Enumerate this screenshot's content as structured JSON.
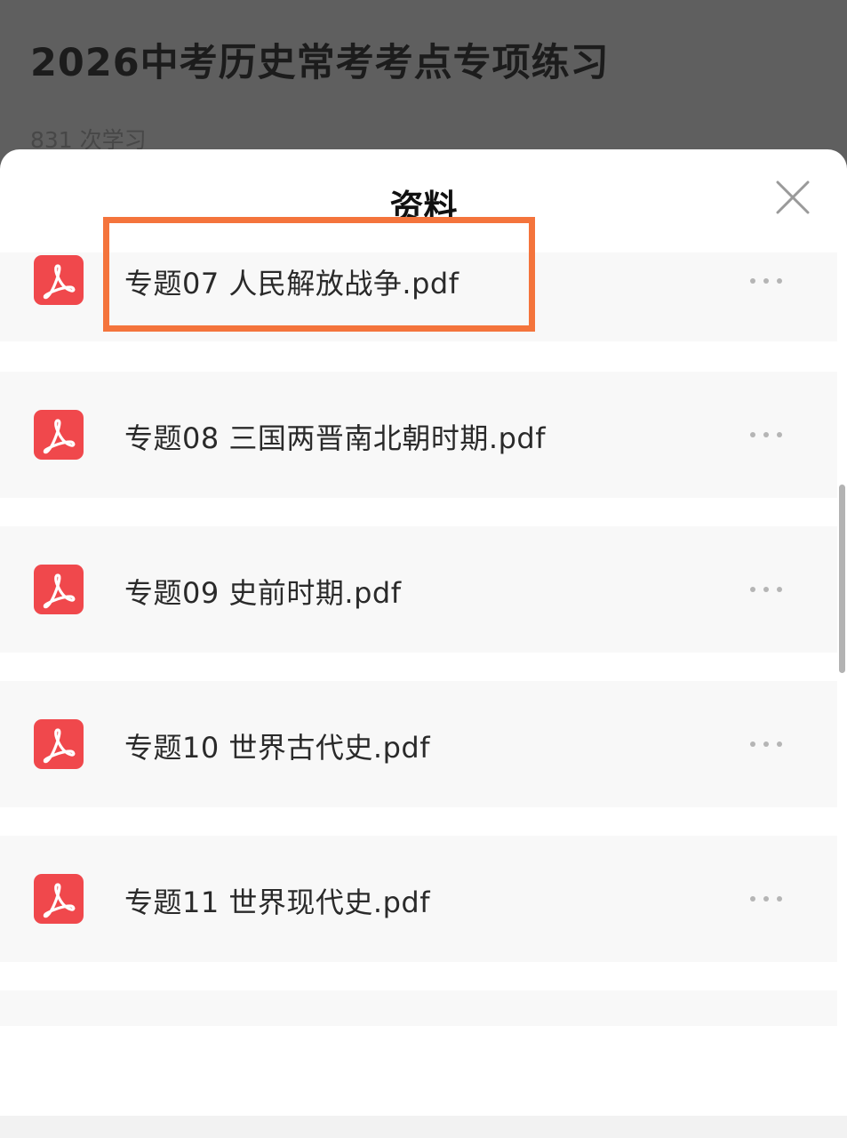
{
  "background_page": {
    "title": "2026中考历史常考考点专项练习",
    "study_count": "831 次学习"
  },
  "sheet": {
    "title": "资料",
    "close_icon": "close-icon"
  },
  "files": [
    {
      "name": "专题07 人民解放战争.pdf",
      "icon": "pdf-icon",
      "more": "more-icon"
    },
    {
      "name": "专题08 三国两晋南北朝时期.pdf",
      "icon": "pdf-icon",
      "more": "more-icon"
    },
    {
      "name": "专题09 史前时期.pdf",
      "icon": "pdf-icon",
      "more": "more-icon"
    },
    {
      "name": "专题10 世界古代史.pdf",
      "icon": "pdf-icon",
      "more": "more-icon"
    },
    {
      "name": "专题11 世界现代史.pdf",
      "icon": "pdf-icon",
      "more": "more-icon"
    }
  ],
  "colors": {
    "pdf_icon_bg": "#f0484c",
    "highlight": "#f4743c",
    "overlay": "#5f5f5f"
  }
}
